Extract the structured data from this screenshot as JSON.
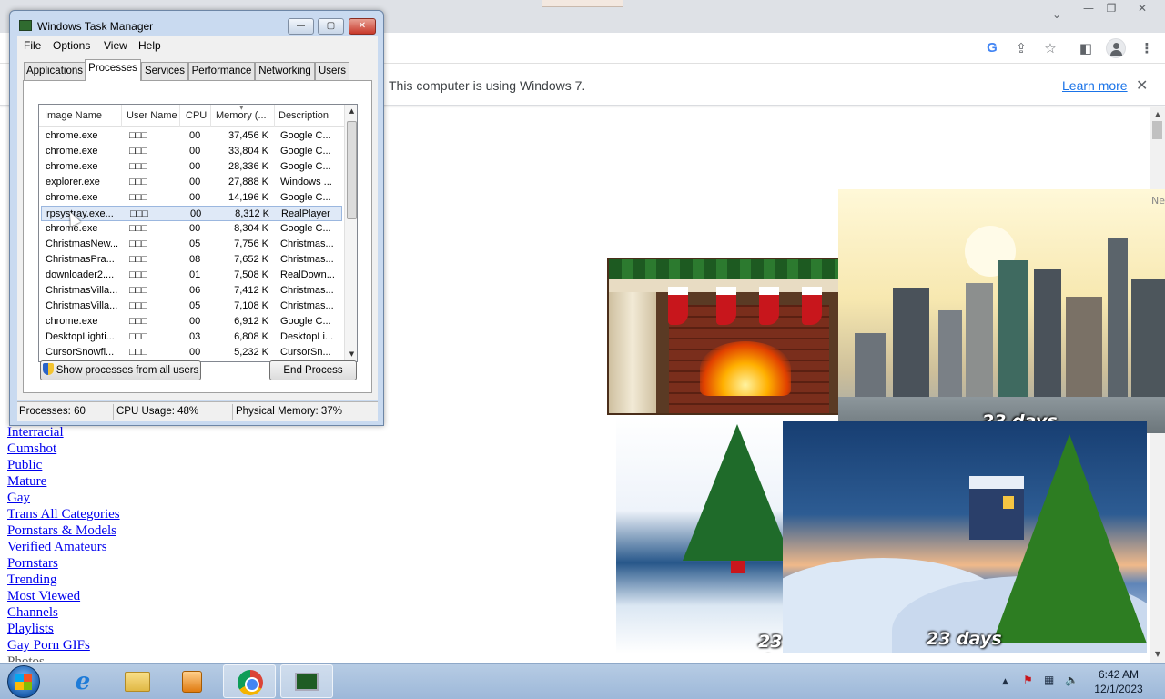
{
  "browser": {
    "window_controls": {
      "minimize": "—",
      "restore": "❐",
      "close": "✕",
      "tab_list": "⌄"
    },
    "toolbar_icons": [
      "google-icon",
      "share-icon",
      "bookmark-star-icon",
      "side-panel-icon",
      "profile-icon",
      "menu-icon"
    ],
    "infobar": {
      "message": "This computer is using Windows 7.",
      "learn_more": "Learn more",
      "close": "✕"
    },
    "links": [
      "Interracial",
      "Cumshot",
      "Public",
      "Mature",
      "Gay",
      "Trans All Categories",
      "Pornstars & Models",
      "Verified Amateurs",
      "Pornstars",
      "Trending",
      "Most Viewed",
      "Channels",
      "Playlists",
      "Gay Porn GIFs",
      "Photos"
    ],
    "widgets": {
      "city_countdown": "23 days",
      "snow_countdown": "23 days",
      "tree_countdown": "23 days",
      "edge_text": "Ne"
    }
  },
  "task_manager": {
    "title": "Windows Task Manager",
    "title_buttons": {
      "minimize": "—",
      "maximize": "▢",
      "close": "✕"
    },
    "menu": [
      "File",
      "Options",
      "View",
      "Help"
    ],
    "tabs": [
      "Applications",
      "Processes",
      "Services",
      "Performance",
      "Networking",
      "Users"
    ],
    "active_tab": "Processes",
    "columns": [
      "Image Name",
      "User Name",
      "CPU",
      "Memory (...",
      "Description"
    ],
    "rows": [
      {
        "image": "chrome.exe",
        "user": "□□□",
        "cpu": "00",
        "memory": "37,456 K",
        "desc": "Google C..."
      },
      {
        "image": "chrome.exe",
        "user": "□□□",
        "cpu": "00",
        "memory": "33,804 K",
        "desc": "Google C..."
      },
      {
        "image": "chrome.exe",
        "user": "□□□",
        "cpu": "00",
        "memory": "28,336 K",
        "desc": "Google C..."
      },
      {
        "image": "explorer.exe",
        "user": "□□□",
        "cpu": "00",
        "memory": "27,888 K",
        "desc": "Windows ..."
      },
      {
        "image": "chrome.exe",
        "user": "□□□",
        "cpu": "00",
        "memory": "14,196 K",
        "desc": "Google C..."
      },
      {
        "image": "rpsystray.exe...",
        "user": "□□□",
        "cpu": "00",
        "memory": "8,312 K",
        "desc": "RealPlayer",
        "selected": true
      },
      {
        "image": "chrome.exe",
        "user": "□□□",
        "cpu": "00",
        "memory": "8,304 K",
        "desc": "Google C..."
      },
      {
        "image": "ChristmasNew...",
        "user": "□□□",
        "cpu": "05",
        "memory": "7,756 K",
        "desc": "Christmas..."
      },
      {
        "image": "ChristmasPra...",
        "user": "□□□",
        "cpu": "08",
        "memory": "7,652 K",
        "desc": "Christmas..."
      },
      {
        "image": "downloader2....",
        "user": "□□□",
        "cpu": "01",
        "memory": "7,508 K",
        "desc": "RealDown..."
      },
      {
        "image": "ChristmasVilla...",
        "user": "□□□",
        "cpu": "06",
        "memory": "7,412 K",
        "desc": "Christmas..."
      },
      {
        "image": "ChristmasVilla...",
        "user": "□□□",
        "cpu": "05",
        "memory": "7,108 K",
        "desc": "Christmas..."
      },
      {
        "image": "chrome.exe",
        "user": "□□□",
        "cpu": "00",
        "memory": "6,912 K",
        "desc": "Google C..."
      },
      {
        "image": "DesktopLighti...",
        "user": "□□□",
        "cpu": "03",
        "memory": "6,808 K",
        "desc": "DesktopLi..."
      },
      {
        "image": "CursorSnowfl...",
        "user": "□□□",
        "cpu": "00",
        "memory": "5,232 K",
        "desc": "CursorSn..."
      }
    ],
    "show_all_button": "Show processes from all users",
    "end_process_button": "End Process",
    "status": {
      "processes": "Processes: 60",
      "cpu": "CPU Usage: 48%",
      "memory": "Physical Memory: 37%"
    }
  },
  "taskbar": {
    "items": [
      "start-button",
      "internet-explorer",
      "windows-explorer",
      "media-player",
      "google-chrome",
      "task-manager"
    ],
    "active_item": "task-manager",
    "tray": {
      "show_hidden": "▲",
      "flag": "⚑",
      "network": "▦",
      "volume": "🔈"
    },
    "time": "6:42 AM",
    "date": "12/1/2023"
  }
}
